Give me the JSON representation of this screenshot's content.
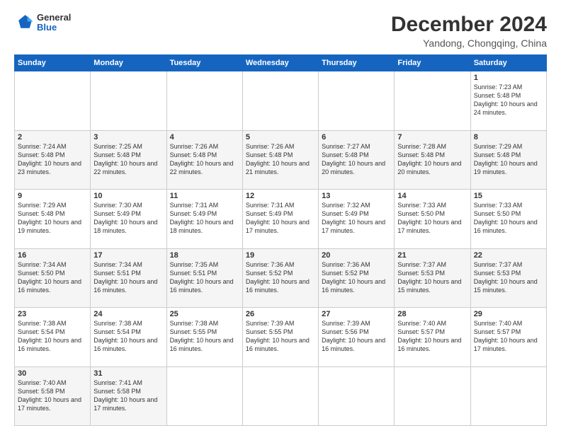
{
  "header": {
    "logo": {
      "general": "General",
      "blue": "Blue"
    },
    "title": "December 2024",
    "location": "Yandong, Chongqing, China"
  },
  "calendar": {
    "weekdays": [
      "Sunday",
      "Monday",
      "Tuesday",
      "Wednesday",
      "Thursday",
      "Friday",
      "Saturday"
    ],
    "weeks": [
      [
        null,
        null,
        null,
        null,
        null,
        null,
        {
          "day": "1",
          "sunrise": "7:23 AM",
          "sunset": "5:48 PM",
          "daylight": "10 hours and 24 minutes."
        },
        {
          "day": "2",
          "sunrise": "7:24 AM",
          "sunset": "5:48 PM",
          "daylight": "10 hours and 23 minutes."
        },
        {
          "day": "3",
          "sunrise": "7:25 AM",
          "sunset": "5:48 PM",
          "daylight": "10 hours and 22 minutes."
        },
        {
          "day": "4",
          "sunrise": "7:26 AM",
          "sunset": "5:48 PM",
          "daylight": "10 hours and 22 minutes."
        },
        {
          "day": "5",
          "sunrise": "7:26 AM",
          "sunset": "5:48 PM",
          "daylight": "10 hours and 21 minutes."
        },
        {
          "day": "6",
          "sunrise": "7:27 AM",
          "sunset": "5:48 PM",
          "daylight": "10 hours and 20 minutes."
        },
        {
          "day": "7",
          "sunrise": "7:28 AM",
          "sunset": "5:48 PM",
          "daylight": "10 hours and 20 minutes."
        }
      ],
      [
        {
          "day": "8",
          "sunrise": "7:29 AM",
          "sunset": "5:48 PM",
          "daylight": "10 hours and 19 minutes."
        },
        {
          "day": "9",
          "sunrise": "7:29 AM",
          "sunset": "5:48 PM",
          "daylight": "10 hours and 19 minutes."
        },
        {
          "day": "10",
          "sunrise": "7:30 AM",
          "sunset": "5:49 PM",
          "daylight": "10 hours and 18 minutes."
        },
        {
          "day": "11",
          "sunrise": "7:31 AM",
          "sunset": "5:49 PM",
          "daylight": "10 hours and 18 minutes."
        },
        {
          "day": "12",
          "sunrise": "7:31 AM",
          "sunset": "5:49 PM",
          "daylight": "10 hours and 17 minutes."
        },
        {
          "day": "13",
          "sunrise": "7:32 AM",
          "sunset": "5:49 PM",
          "daylight": "10 hours and 17 minutes."
        },
        {
          "day": "14",
          "sunrise": "7:33 AM",
          "sunset": "5:50 PM",
          "daylight": "10 hours and 17 minutes."
        }
      ],
      [
        {
          "day": "15",
          "sunrise": "7:33 AM",
          "sunset": "5:50 PM",
          "daylight": "10 hours and 16 minutes."
        },
        {
          "day": "16",
          "sunrise": "7:34 AM",
          "sunset": "5:50 PM",
          "daylight": "10 hours and 16 minutes."
        },
        {
          "day": "17",
          "sunrise": "7:34 AM",
          "sunset": "5:51 PM",
          "daylight": "10 hours and 16 minutes."
        },
        {
          "day": "18",
          "sunrise": "7:35 AM",
          "sunset": "5:51 PM",
          "daylight": "10 hours and 16 minutes."
        },
        {
          "day": "19",
          "sunrise": "7:36 AM",
          "sunset": "5:52 PM",
          "daylight": "10 hours and 16 minutes."
        },
        {
          "day": "20",
          "sunrise": "7:36 AM",
          "sunset": "5:52 PM",
          "daylight": "10 hours and 16 minutes."
        },
        {
          "day": "21",
          "sunrise": "7:37 AM",
          "sunset": "5:53 PM",
          "daylight": "10 hours and 15 minutes."
        }
      ],
      [
        {
          "day": "22",
          "sunrise": "7:37 AM",
          "sunset": "5:53 PM",
          "daylight": "10 hours and 15 minutes."
        },
        {
          "day": "23",
          "sunrise": "7:38 AM",
          "sunset": "5:54 PM",
          "daylight": "10 hours and 16 minutes."
        },
        {
          "day": "24",
          "sunrise": "7:38 AM",
          "sunset": "5:54 PM",
          "daylight": "10 hours and 16 minutes."
        },
        {
          "day": "25",
          "sunrise": "7:38 AM",
          "sunset": "5:55 PM",
          "daylight": "10 hours and 16 minutes."
        },
        {
          "day": "26",
          "sunrise": "7:39 AM",
          "sunset": "5:55 PM",
          "daylight": "10 hours and 16 minutes."
        },
        {
          "day": "27",
          "sunrise": "7:39 AM",
          "sunset": "5:56 PM",
          "daylight": "10 hours and 16 minutes."
        },
        {
          "day": "28",
          "sunrise": "7:40 AM",
          "sunset": "5:57 PM",
          "daylight": "10 hours and 16 minutes."
        }
      ],
      [
        {
          "day": "29",
          "sunrise": "7:40 AM",
          "sunset": "5:57 PM",
          "daylight": "10 hours and 17 minutes."
        },
        {
          "day": "30",
          "sunrise": "7:40 AM",
          "sunset": "5:58 PM",
          "daylight": "10 hours and 17 minutes."
        },
        {
          "day": "31",
          "sunrise": "7:41 AM",
          "sunset": "5:58 PM",
          "daylight": "10 hours and 17 minutes."
        },
        null,
        null,
        null,
        null
      ]
    ]
  }
}
